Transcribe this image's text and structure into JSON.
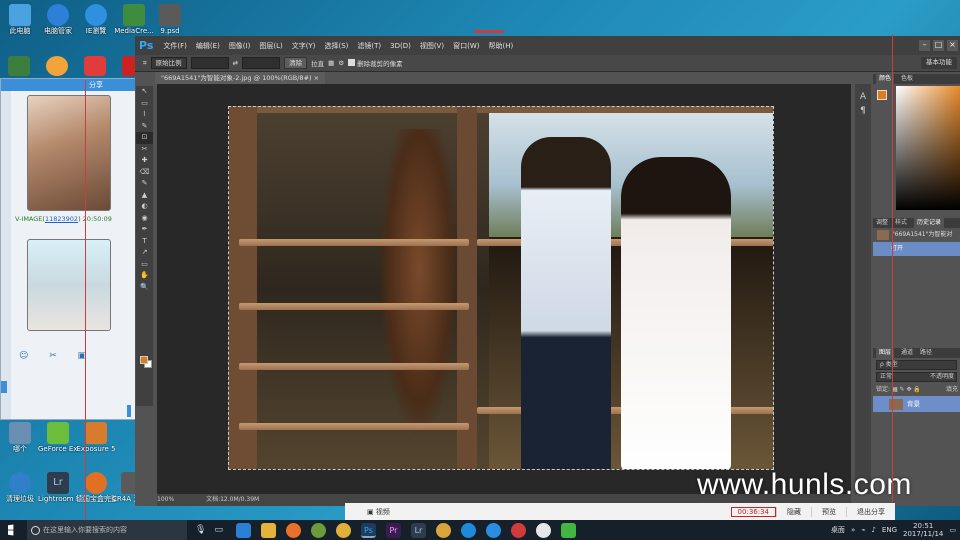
{
  "desktop_icons": [
    {
      "label": "此电脑",
      "color": "#4aa3e0"
    },
    {
      "label": "电脑管家",
      "color": "#2e7fd8"
    },
    {
      "label": "IE瀏覽",
      "color": "#2f8fe0"
    },
    {
      "label": "MediaCre...",
      "color": "#3e8d3e"
    },
    {
      "label": "9.psd",
      "color": "#5a5a5a"
    },
    {
      "label": "GeForce Experience",
      "color": "#6cbd3c"
    },
    {
      "label": "Exposure 5",
      "color": "#d97b2c"
    },
    {
      "label": "Lightroom 5.7 64 位",
      "color": "#2e3c4e"
    },
    {
      "label": "德国宝盒完整版",
      "color": "#e27024"
    },
    {
      "label": "CR4A 为智能对象...",
      "color": "#5a5a5a"
    },
    {
      "label": "清理垃圾",
      "color": "#2f80c9"
    },
    {
      "label": "哪个",
      "color": "#6a8fb3"
    }
  ],
  "chat": {
    "titlebar": "分享",
    "sender": "V-IMAGE",
    "sender_id": "11823902",
    "time": "20:50:09",
    "tools": "☺ ✂ ▣"
  },
  "ps": {
    "logo": "Ps",
    "menus": [
      "文件(F)",
      "编辑(E)",
      "图像(I)",
      "图层(L)",
      "文字(Y)",
      "选择(S)",
      "滤镜(T)",
      "3D(D)",
      "视图(V)",
      "窗口(W)",
      "帮助(H)"
    ],
    "window_buttons": [
      "–",
      "□",
      "×"
    ],
    "options": {
      "ratio": "原始比例",
      "clear": "清除",
      "straighten": "拉直",
      "delete_cropped": "删除裁剪的像素",
      "workspace": "基本功能"
    },
    "doc_tab": "\"669A1541\"为智能对象-2.jpg @ 100%(RGB/8#)",
    "status_zoom": "100%",
    "status_doc": "文档:12.0M/0.39M",
    "tools": [
      "↖",
      "▭",
      "⌇",
      "✎",
      "⊡",
      "✂",
      "✚",
      "⌫",
      "✎",
      "▲",
      "◐",
      "◉",
      "✒",
      "T",
      "↗",
      "▭",
      "✋",
      "🔍"
    ],
    "panels": {
      "color_tabs": [
        "颜色",
        "色板"
      ],
      "history_tabs": [
        "调整",
        "样式",
        "历史记录"
      ],
      "history_items": [
        "\"669A1541\"为智能对",
        "打开"
      ],
      "layer_tabs": [
        "图层",
        "通道",
        "路径"
      ],
      "layer_kind": "ρ 类型",
      "blend_mode": "正常",
      "opacity_label": "不透明度",
      "lock_label": "锁定:",
      "fill_label": "填充",
      "layer_name": "背景",
      "accent_fg": "#e07b19"
    }
  },
  "watermark": "www.hunls.com",
  "recording_bar": {
    "tab": "视频",
    "timer": "00:36:34",
    "buttons": [
      "隐藏",
      "预览",
      "退出分享"
    ]
  },
  "taskbar": {
    "search_placeholder": "在这里输入你要搜索的内容",
    "apps": [
      {
        "name": "edge",
        "color": "#2b7fd4"
      },
      {
        "name": "files",
        "color": "#e6b33a"
      },
      {
        "name": "firefox",
        "color": "#e8702a"
      },
      {
        "name": "store",
        "color": "#6c9c3a"
      },
      {
        "name": "chrome",
        "color": "#e0b03a"
      },
      {
        "name": "ps",
        "color": "#1e3a5c"
      },
      {
        "name": "premiere",
        "color": "#3a1d4e"
      },
      {
        "name": "lightroom",
        "color": "#2e3c4e"
      },
      {
        "name": "chrome2",
        "color": "#d9a43a"
      },
      {
        "name": "ie",
        "color": "#1f8ad8"
      },
      {
        "name": "qq",
        "color": "#2a8ee0"
      },
      {
        "name": "netease",
        "color": "#d23b3b"
      },
      {
        "name": "chat",
        "color": "#e7e7e7"
      },
      {
        "name": "wechat",
        "color": "#42b542"
      }
    ],
    "desktop_label": "桌面",
    "ime": "ENG",
    "time": "20:51",
    "date": "2017/11/14"
  }
}
